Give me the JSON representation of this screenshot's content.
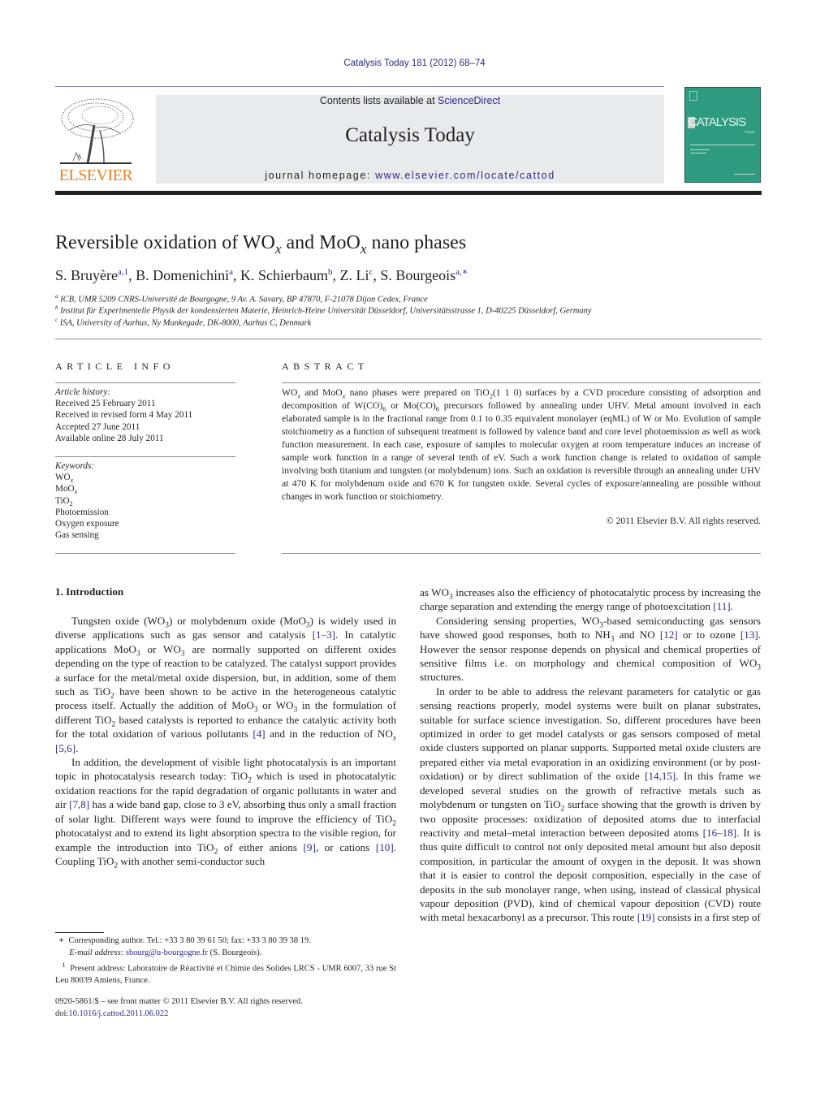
{
  "header": {
    "citation": "Catalysis Today 181 (2012) 68–74",
    "contents_prefix": "Contents lists available at ",
    "contents_link": "ScienceDirect",
    "journal_title": "Catalysis Today",
    "homepage_prefix": "journal homepage: ",
    "homepage_link": "www.elsevier.com/locate/cattod",
    "publisher_logo_text": "ELSEVIER",
    "cover_title": "CATALYSIS",
    "cover_subtitle": "TODAY",
    "colors": {
      "link": "#2a2a8c",
      "elsevier_orange": "#f07f1c",
      "cover_green": "#2e9a7e",
      "banner_gray": "#e9eaec"
    }
  },
  "article": {
    "title_parts": [
      "Reversible oxidation of WO",
      "x",
      " and MoO",
      "x",
      " nano phases"
    ],
    "authors": [
      {
        "name": "S. Bruyère",
        "sup": "a,1"
      },
      {
        "name": "B. Domenichini",
        "sup": "a"
      },
      {
        "name": "K. Schierbaum",
        "sup": "b"
      },
      {
        "name": "Z. Li",
        "sup": "c"
      },
      {
        "name": "S. Bourgeois",
        "sup": "a,∗"
      }
    ],
    "affiliations": [
      {
        "key": "a",
        "text": "ICB, UMR 5209 CNRS-Université de Bourgogne, 9 Av. A. Savary, BP 47870, F-21078 Dijon Cedex, France"
      },
      {
        "key": "b",
        "text": "Institut für Experimentelle Physik der kondensierten Materie, Heinrich-Heine Universität Düsseldorf, Universitätsstrasse 1, D-40225 Düsseldorf, Germany"
      },
      {
        "key": "c",
        "text": "ISA, University of Aarhus, Ny Munkegade, DK-8000, Aarhus C, Denmark"
      }
    ]
  },
  "article_info": {
    "heading": "ARTICLE INFO",
    "history_label": "Article history:",
    "history": [
      "Received 25 February 2011",
      "Received in revised form 4 May 2011",
      "Accepted 27 June 2011",
      "Available online 28 July 2011"
    ],
    "keywords_label": "Keywords:",
    "keywords": [
      {
        "base": "WO",
        "sub": "x",
        "italic_sub": true
      },
      {
        "base": "MoO",
        "sub": "x",
        "italic_sub": true
      },
      {
        "base": "TiO",
        "sub": "2",
        "italic_sub": false
      },
      {
        "base": "Photoemission",
        "sub": ""
      },
      {
        "base": "Oxygen exposure",
        "sub": ""
      },
      {
        "base": "Gas sensing",
        "sub": ""
      }
    ]
  },
  "abstract": {
    "heading": "ABSTRACT",
    "html": "WO<sub><i>x</i></sub> and MoO<sub><i>x</i></sub> nano phases were prepared on TiO<sub>2</sub>(1 1 0) surfaces by a CVD procedure consisting of adsorption and decomposition of W(CO)<sub>6</sub> or Mo(CO)<sub>6</sub> precursors followed by annealing under UHV. Metal amount involved in each elaborated sample is in the fractional range from 0.1 to 0.35 equivalent monolayer (eqML) of W or Mo. Evolution of sample stoichiometry as a function of subsequent treatment is followed by valence band and core level photoemission as well as work function measurement. In each case, exposure of samples to molecular oxygen at room temperature induces an increase of sample work function in a range of several tenth of eV. Such a work function change is related to oxidation of sample involving both titanium and tungsten (or molybdenum) ions. Such an oxidation is reversible through an annealing under UHV at 470 K for molybdenum oxide and 670 K for tungsten oxide. Several cycles of exposure/annealing are possible without changes in work function or stoichiometry.",
    "copyright": "© 2011 Elsevier B.V. All rights reserved."
  },
  "body": {
    "section_heading": "1.  Introduction",
    "left_paragraphs": [
      "Tungsten oxide (WO<sub>3</sub>) or molybdenum oxide (MoO<sub>3</sub>) is widely used in diverse applications such as gas sensor and catalysis <span class=\"cite\">[1–3]</span>. In catalytic applications MoO<sub>3</sub> or WO<sub>3</sub> are normally supported on different oxides depending on the type of reaction to be catalyzed. The catalyst support provides a surface for the metal/metal oxide dispersion, but, in addition, some of them such as TiO<sub>2</sub> have been shown to be active in the heterogeneous catalytic process itself. Actually the addition of MoO<sub>3</sub> or WO<sub>3</sub> in the formulation of different TiO<sub>2</sub> based catalysts is reported to enhance the catalytic activity both for the total oxidation of various pollutants <span class=\"cite\">[4]</span> and in the reduction of NO<sub><i>x</i></sub> <span class=\"cite\">[5,6]</span>.",
      "In addition, the development of visible light photocatalysis is an important topic in photocatalysis research today: TiO<sub>2</sub> which is used in photocatalytic oxidation reactions for the rapid degradation of organic pollutants in water and air <span class=\"cite\">[7,8]</span> has a wide band gap, close to 3 eV, absorbing thus only a small fraction of solar light. Different ways were found to improve the efficiency of TiO<sub>2</sub> photocatalyst and to extend its light absorption spectra to the visible region, for example the introduction into TiO<sub>2</sub> of either anions <span class=\"cite\">[9]</span>, or cations <span class=\"cite\">[10]</span>. Coupling TiO<sub>2</sub> with another semi-conductor such"
    ],
    "right_paragraphs": [
      {
        "indent": false,
        "html": "as WO<sub>3</sub> increases also the efficiency of photocatalytic process by increasing the charge separation and extending the energy range of photoexcitation <span class=\"cite\">[11]</span>."
      },
      {
        "indent": true,
        "html": "Considering sensing properties, WO<sub>3</sub>-based semiconducting gas sensors have showed good responses, both to NH<sub>3</sub> and NO <span class=\"cite\">[12]</span> or to ozone <span class=\"cite\">[13]</span>. However the sensor response depends on physical and chemical properties of sensitive films i.e. on morphology and chemical composition of WO<sub>3</sub> structures."
      },
      {
        "indent": true,
        "html": "In order to be able to address the relevant parameters for catalytic or gas sensing reactions properly, model systems were built on planar substrates, suitable for surface science investigation. So, different procedures have been optimized in order to get model catalysts or gas sensors composed of metal oxide clusters supported on planar supports. Supported metal oxide clusters are prepared either via metal evaporation in an oxidizing environment (or by post-oxidation) or by direct sublimation of the oxide <span class=\"cite\">[14,15]</span>. In this frame we developed several studies on the growth of refractive metals such as molybdenum or tungsten on TiO<sub>2</sub> surface showing that the growth is driven by two opposite processes: oxidization of deposited atoms due to interfacial reactivity and metal–metal interaction between deposited atoms <span class=\"cite\">[16–18]</span>. It is thus quite difficult to control not only deposited metal amount but also deposit composition, in particular the amount of oxygen in the deposit. It was shown that it is easier to control the deposit composition, especially in the case of deposits in the sub monolayer range, when using, instead of classical physical vapour deposition (PVD), kind of chemical vapour deposition (CVD) route with metal hexacarbonyl as a precursor. This route <span class=\"cite\">[19]</span> consists in a first step of"
      }
    ]
  },
  "footnotes": {
    "corresponding_mark": "∗",
    "corresponding": "Corresponding author. Tel.: +33 3 80 39 61 50; fax: +33 3 80 39 38 19.",
    "email_label": "E-mail address:",
    "email": "sbourg@u-bourgogne.fr",
    "email_suffix": " (S. Bourgeois).",
    "present_mark": "1",
    "present_address": "Present address: Laboratoire de Réactivité et Chimie des Solides LRCS - UMR 6007, 33 rue St Leu 80039 Amiens, France.",
    "issn_line": "0920-5861/$ – see front matter © 2011 Elsevier B.V. All rights reserved.",
    "doi_prefix": "doi:",
    "doi": "10.1016/j.cattod.2011.06.022"
  }
}
